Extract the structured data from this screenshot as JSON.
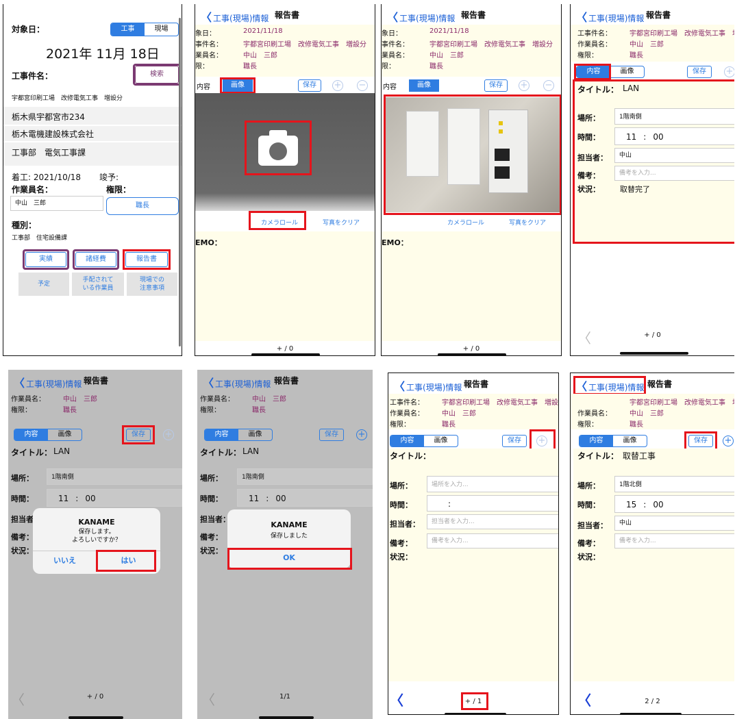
{
  "colors": {
    "highlight": "#e5141c",
    "accent": "#2f7de1",
    "mauve": "#8a2a6a",
    "cream": "#fffdea"
  },
  "p1": {
    "target_label": "対象日：",
    "seg_work": "工事",
    "seg_site": "現場",
    "date": "2021年 11月 18日",
    "job_label": "工事件名：",
    "search": "検索",
    "rows": [
      "宇都宮印刷工場　改修電気工事　増設分",
      "栃木県宇都宮市234",
      "栃木電機建設株式会社",
      "工事部　電気工事課"
    ],
    "start": "着工: 2021/10/18",
    "finish": "竣予:",
    "worker_label": "作業員名：",
    "auth_label": "権限：",
    "worker": "中山　三郎",
    "auth": "職長",
    "type_label": "種別：",
    "type": "工事部　住宅設備課",
    "btn_results": "実績",
    "btn_docs": "諸経費",
    "btn_report": "報告書",
    "btn_plan": "予定",
    "btn_staff": "手配されて\nいる作業員",
    "btn_notes": "現場での\n注意事項"
  },
  "nav": {
    "back": "工事(現場)情報",
    "title": "報告書"
  },
  "info": {
    "date_label": "象日：",
    "date": "2021/11/18",
    "job_label": "事件名：",
    "job": "宇都宮印刷工場　改修電気工事　増設分",
    "worker_label": "業員名：",
    "worker": "中山　三郎",
    "auth_label": "限：",
    "auth": "職長",
    "job_label2": "工事件名：",
    "worker_label2": "作業員名：",
    "auth_label2": "権限："
  },
  "tabs": {
    "content": "内容",
    "image": "画像",
    "save": "保存"
  },
  "image_actions": {
    "camera_roll": "カメラロール",
    "clear": "写真をクリア",
    "memo": "EMO："
  },
  "form": {
    "title_label": "タイトル：",
    "place_label": "場所：",
    "time_label": "時間：",
    "person_label": "担当者：",
    "remarks_label": "備考：",
    "status_label": "状況：",
    "place_ph": "場所を入力...",
    "person_ph": "担当者を入力...",
    "remarks_ph": "備考を入力..."
  },
  "p4": {
    "title": "LAN",
    "place": "1階南側",
    "hour": "11",
    "min": "00",
    "person": "中山",
    "status": "取替完了",
    "page": "+ / 0"
  },
  "p5": {
    "title": "LAN",
    "place": "1階南側",
    "hour": "11",
    "min": "00",
    "dlg_title": "KANAME",
    "dlg_msg": "保存します。\nよろしいですか？",
    "no": "いいえ",
    "yes": "はい",
    "page": "+ / 0"
  },
  "p6": {
    "title": "LAN",
    "place": "1階南側",
    "hour": "11",
    "min": "00",
    "dlg_title": "KANAME",
    "dlg_msg": "保存しました",
    "ok": "OK",
    "page": "1/1"
  },
  "p7": {
    "page": "+ / 1"
  },
  "p8": {
    "title": "取替工事",
    "place": "1階北側",
    "hour": "15",
    "min": "00",
    "person": "中山",
    "page": "2 / 2"
  },
  "pager_empty": "+ / 0"
}
